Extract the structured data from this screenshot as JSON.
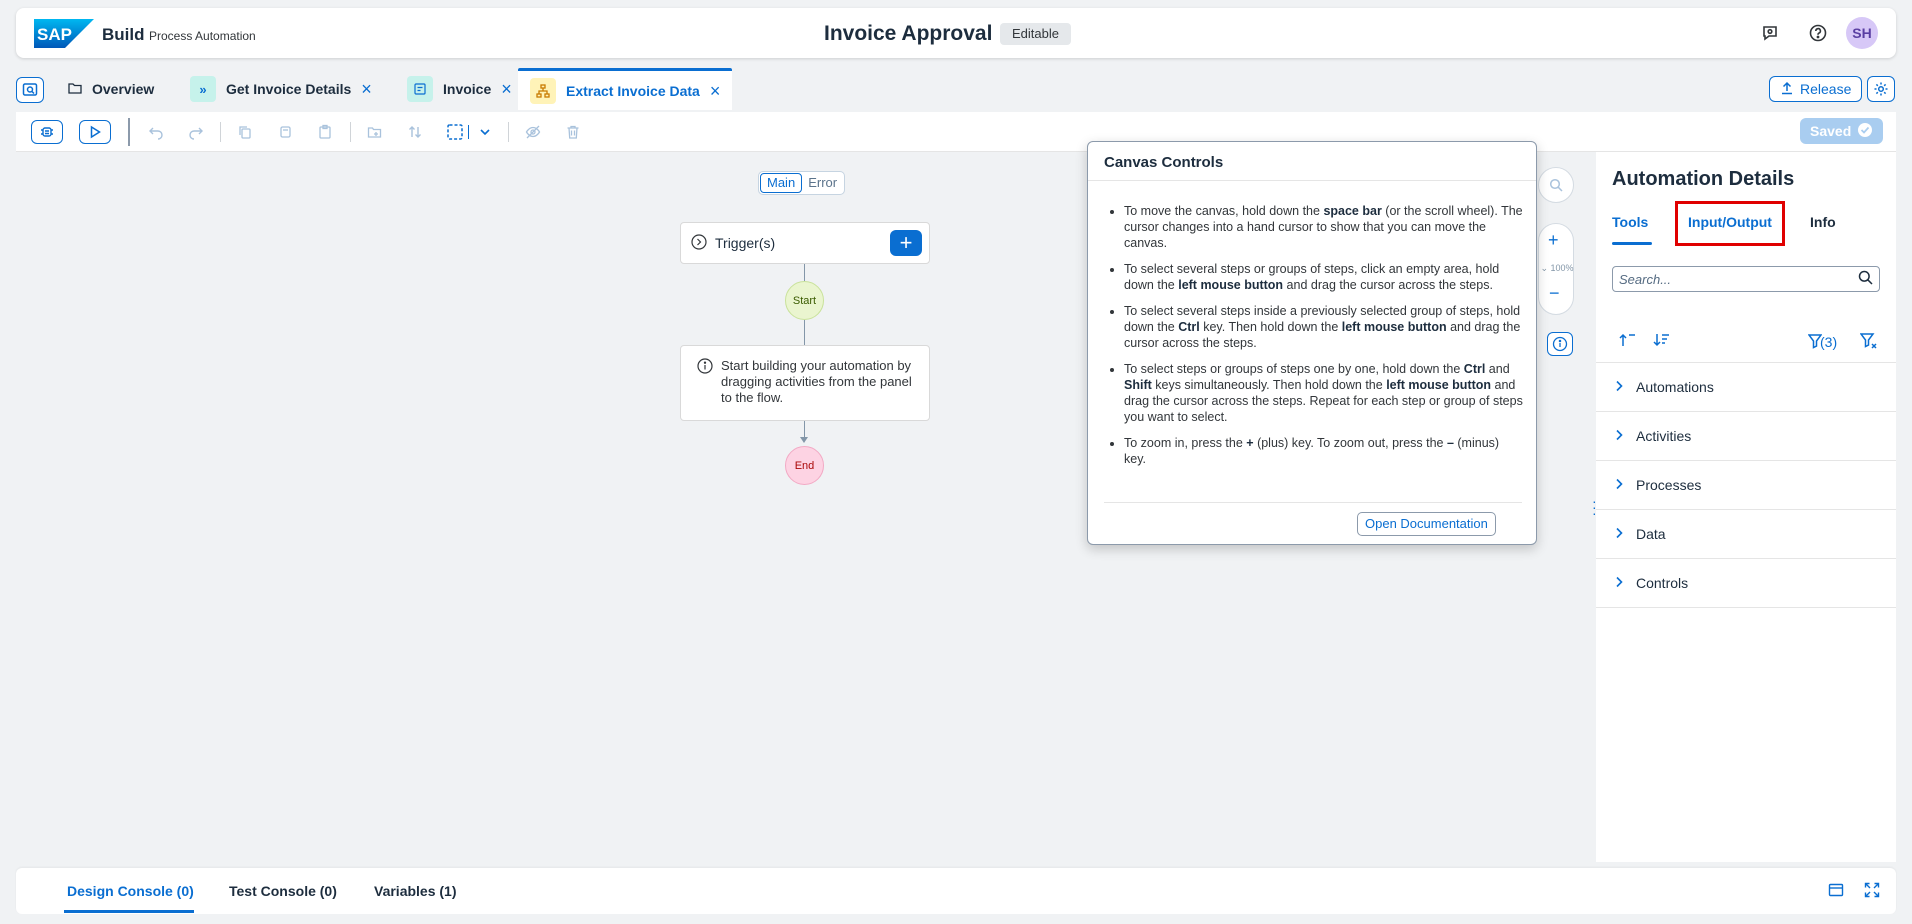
{
  "shell": {
    "brand": "Build",
    "brand_sub": "Process Automation",
    "title": "Invoice Approval",
    "badge": "Editable",
    "avatar": "SH",
    "logo_text": "SAP"
  },
  "tabs": [
    {
      "label": "Overview",
      "icon": "folder-icon"
    },
    {
      "label": "Get Invoice Details",
      "icon": "process-icon",
      "closable": true
    },
    {
      "label": "Invoice",
      "icon": "form-icon",
      "closable": true
    },
    {
      "label": "Extract Invoice Data",
      "icon": "automation-icon",
      "closable": true,
      "active": true
    }
  ],
  "tabbar": {
    "release_label": "Release"
  },
  "toolbar": {
    "saved_label": "Saved"
  },
  "canvas": {
    "flow_tabs": [
      "Main",
      "Error"
    ],
    "trigger_label": "Trigger(s)",
    "start_label": "Start",
    "hint_text": "Start building your automation by dragging activities from the panel to the flow.",
    "end_label": "End",
    "zoom_level": "100%"
  },
  "popover": {
    "title": "Canvas Controls",
    "items": [
      {
        "parts": [
          [
            "To move the canvas, hold down the ",
            false
          ],
          [
            "space bar",
            true
          ],
          [
            " (or the scroll wheel). The cursor changes into a hand cursor to show that you can move the canvas.",
            false
          ]
        ]
      },
      {
        "parts": [
          [
            "To select several steps or groups of steps, click an empty area, hold down the ",
            false
          ],
          [
            "left mouse button",
            true
          ],
          [
            " and drag the cursor across the steps.",
            false
          ]
        ]
      },
      {
        "parts": [
          [
            "To select several steps inside a previously selected group of steps, hold down the ",
            false
          ],
          [
            "Ctrl",
            true
          ],
          [
            " key. Then hold down the ",
            false
          ],
          [
            "left mouse button",
            true
          ],
          [
            " and drag the cursor across the steps.",
            false
          ]
        ]
      },
      {
        "parts": [
          [
            "To select steps or groups of steps one by one, hold down the ",
            false
          ],
          [
            "Ctrl",
            true
          ],
          [
            " and ",
            false
          ],
          [
            "Shift",
            true
          ],
          [
            " keys simultaneously. Then hold down the ",
            false
          ],
          [
            "left mouse button",
            true
          ],
          [
            " and drag the cursor across the steps. Repeat for each step or group of steps you want to select.",
            false
          ]
        ]
      },
      {
        "parts": [
          [
            "To zoom in, press the ",
            false
          ],
          [
            "+",
            true
          ],
          [
            " (plus) key. To zoom out, press the ",
            false
          ],
          [
            "–",
            true
          ],
          [
            " (minus) key.",
            false
          ]
        ]
      }
    ],
    "button": "Open Documentation"
  },
  "right_panel": {
    "title": "Automation Details",
    "tabs": [
      "Tools",
      "Input/Output",
      "Info"
    ],
    "search_placeholder": "Search...",
    "filter_count": "(3)",
    "sections": [
      "Automations",
      "Activities",
      "Processes",
      "Data",
      "Controls"
    ]
  },
  "console": {
    "tabs": [
      "Design Console (0)",
      "Test Console (0)",
      "Variables (1)"
    ]
  },
  "colors": {
    "accent": "#0a6ed1",
    "highlight": "#e00000"
  }
}
